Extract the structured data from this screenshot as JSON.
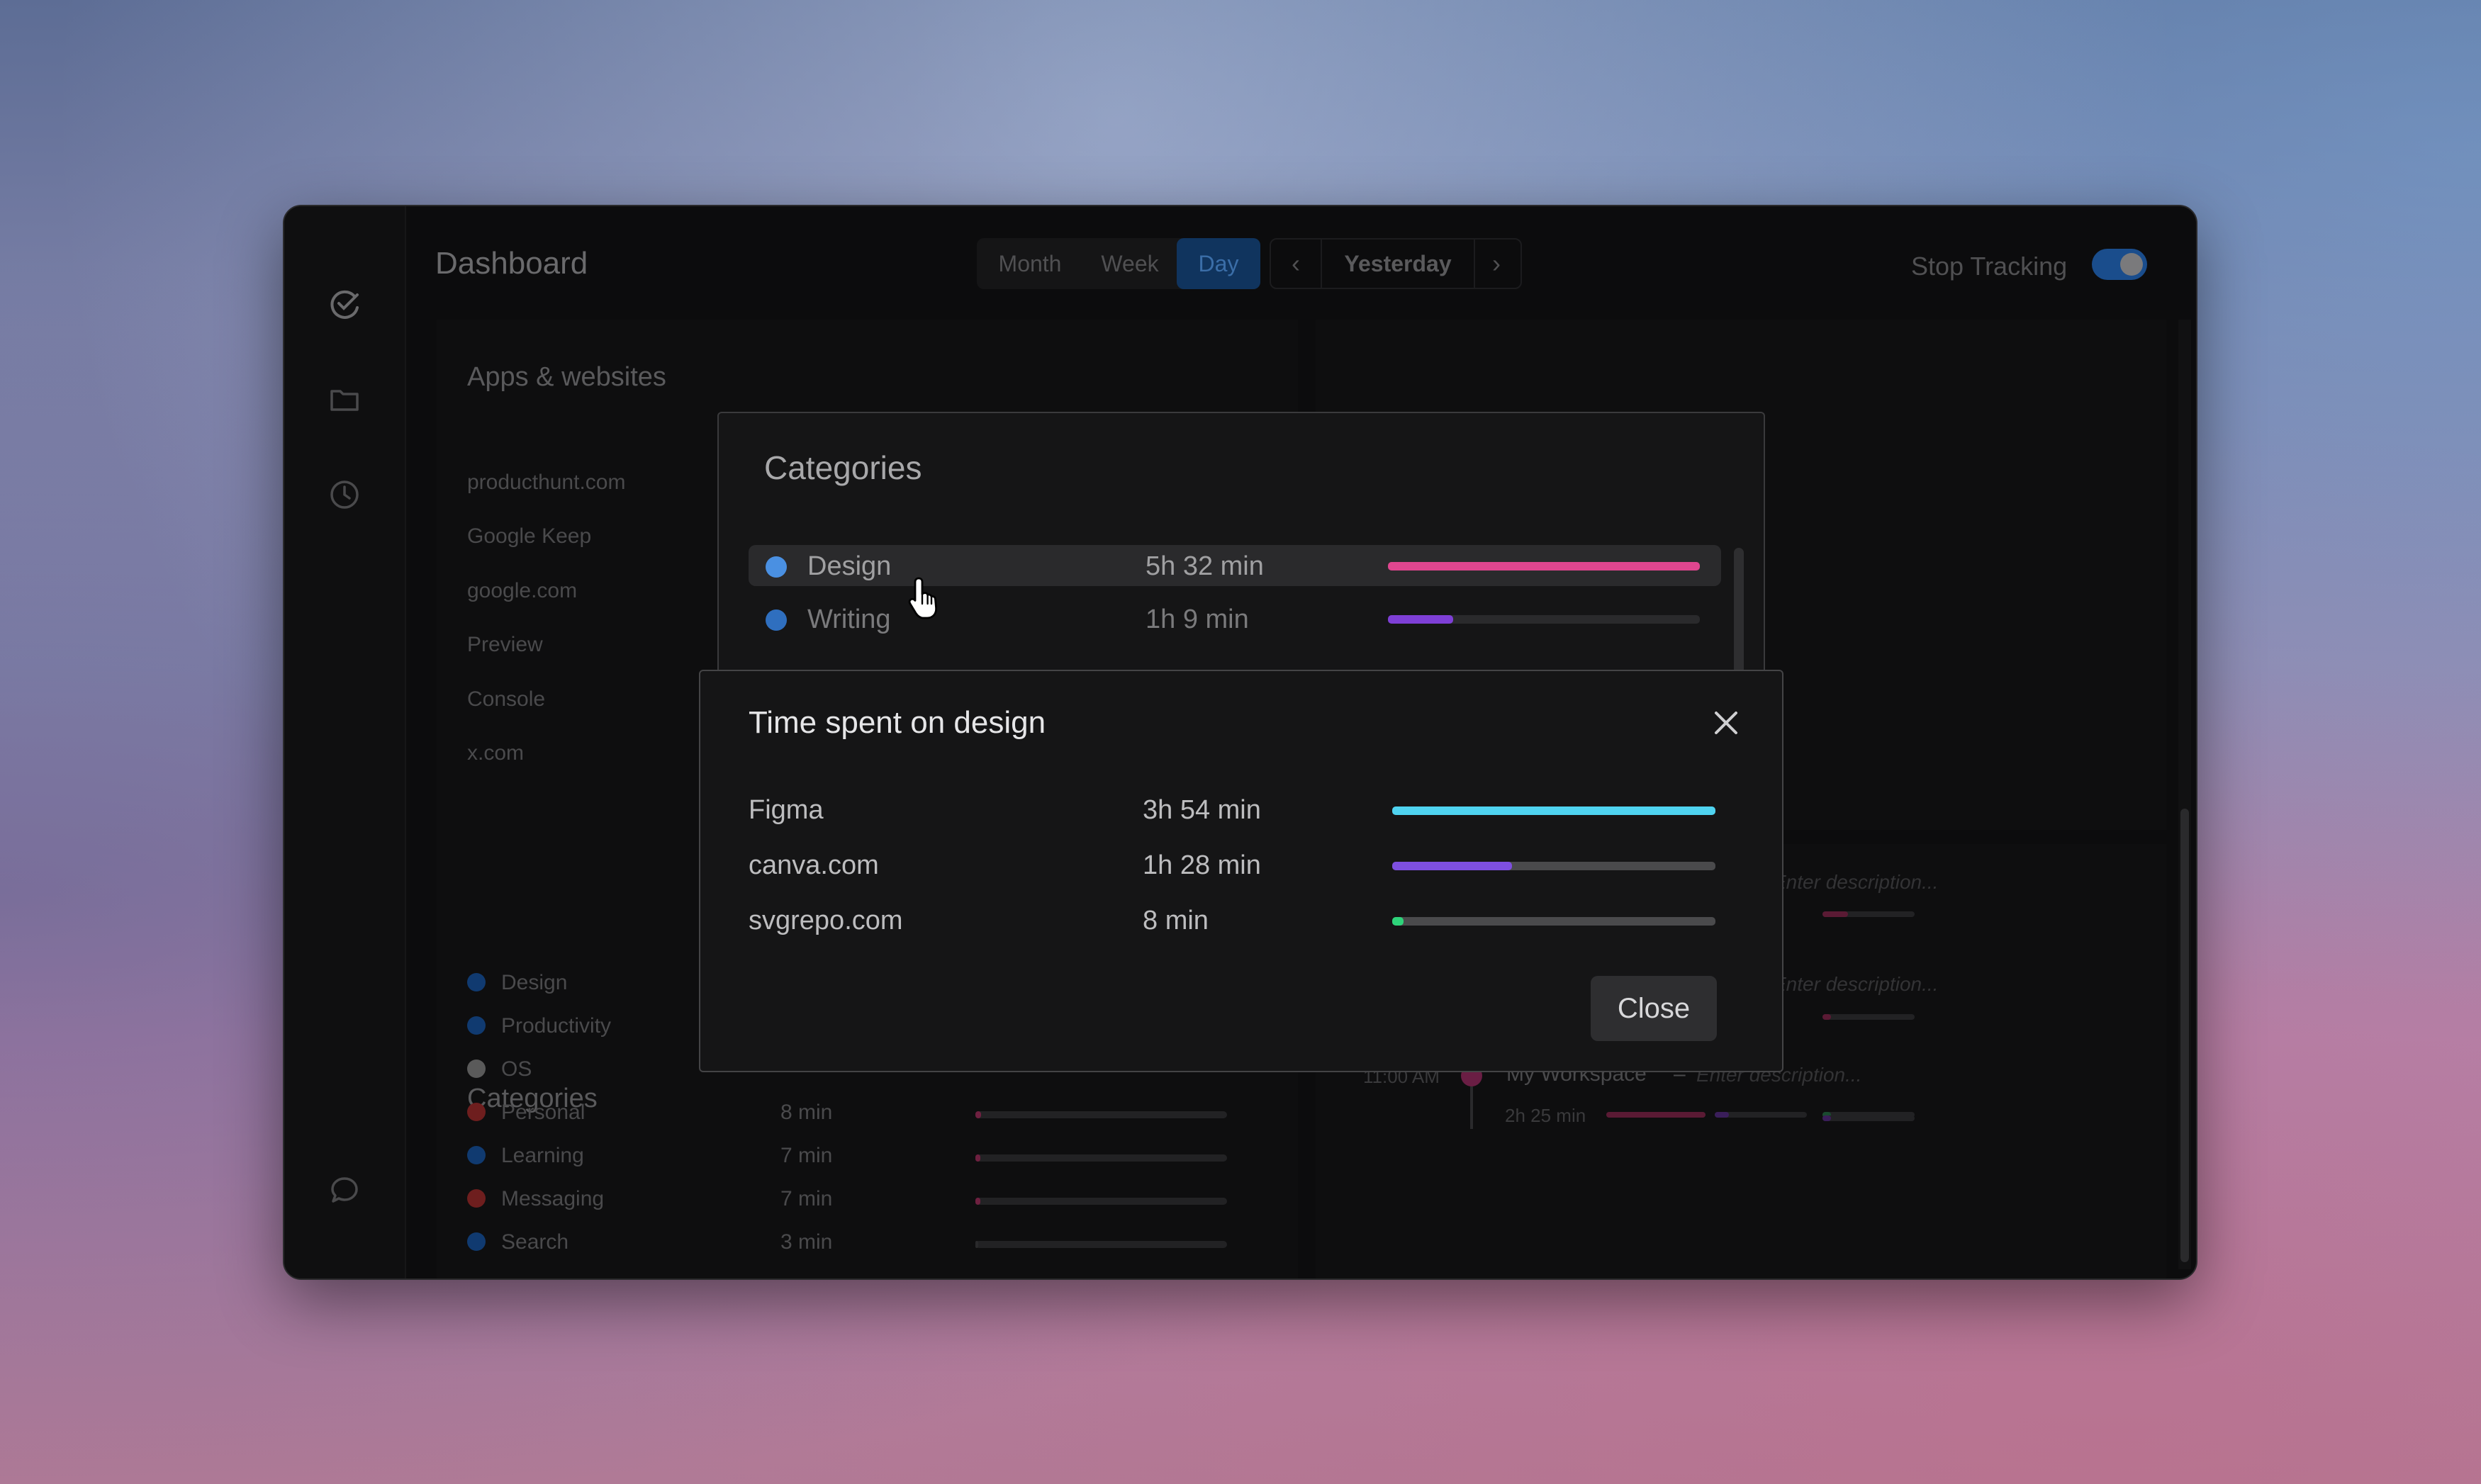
{
  "app": {
    "title": "Dashboard",
    "segments": [
      "Month",
      "Week",
      "Day"
    ],
    "date_label": "Yesterday",
    "prev_label": "‹",
    "next_label": "›",
    "stop_tracking": "Stop Tracking"
  },
  "apps_panel": {
    "title": "Apps & websites",
    "items": [
      "producthunt.com",
      "Google Keep",
      "google.com",
      "Preview",
      "Console",
      "x.com"
    ]
  },
  "categories_panel": {
    "title": "Categories",
    "items": [
      {
        "name": "Design",
        "color": "#1e6fd9"
      },
      {
        "name": "Productivity",
        "color": "#1e6fd9"
      },
      {
        "name": "OS",
        "color": "#9a9a9a"
      },
      {
        "name": "Personal",
        "color": "#d63a3a"
      },
      {
        "name": "Learning",
        "color": "#1e6fd9"
      },
      {
        "name": "Messaging",
        "color": "#d63a3a"
      },
      {
        "name": "Search",
        "color": "#1e6fd9"
      }
    ],
    "times": [
      "8 min",
      "7 min",
      "7 min",
      "3 min"
    ]
  },
  "timeline": {
    "time": "11:00 AM",
    "name": "My Workspace",
    "separator": "–",
    "placeholder": "Enter description...",
    "duration": "2h 25 min"
  },
  "categories_dialog": {
    "title": "Categories",
    "rows": [
      {
        "name": "Design",
        "time": "5h 32 min",
        "color": "#4a90e2",
        "bar_color": "#e0468f",
        "fraction": 1.0
      },
      {
        "name": "Writing",
        "time": "1h 9 min",
        "color": "#2f6fbf",
        "bar_color": "#7e3fd6",
        "fraction": 0.21
      }
    ]
  },
  "design_dialog": {
    "title": "Time spent on design",
    "rows": [
      {
        "name": "Figma",
        "time": "3h 54 min",
        "bar_color": "#4fd3f0",
        "fraction": 1.0
      },
      {
        "name": "canva.com",
        "time": "1h 28 min",
        "bar_color": "#7e4fe0",
        "fraction": 0.37
      },
      {
        "name": "svgrepo.com",
        "time": "8 min",
        "bar_color": "#2ed47a",
        "fraction": 0.035
      }
    ],
    "close_label": "Close",
    "icons": {
      "close": "close-icon"
    }
  },
  "colors": {
    "accent": "#1a5fb4",
    "toggle": "#1a4d8c"
  }
}
